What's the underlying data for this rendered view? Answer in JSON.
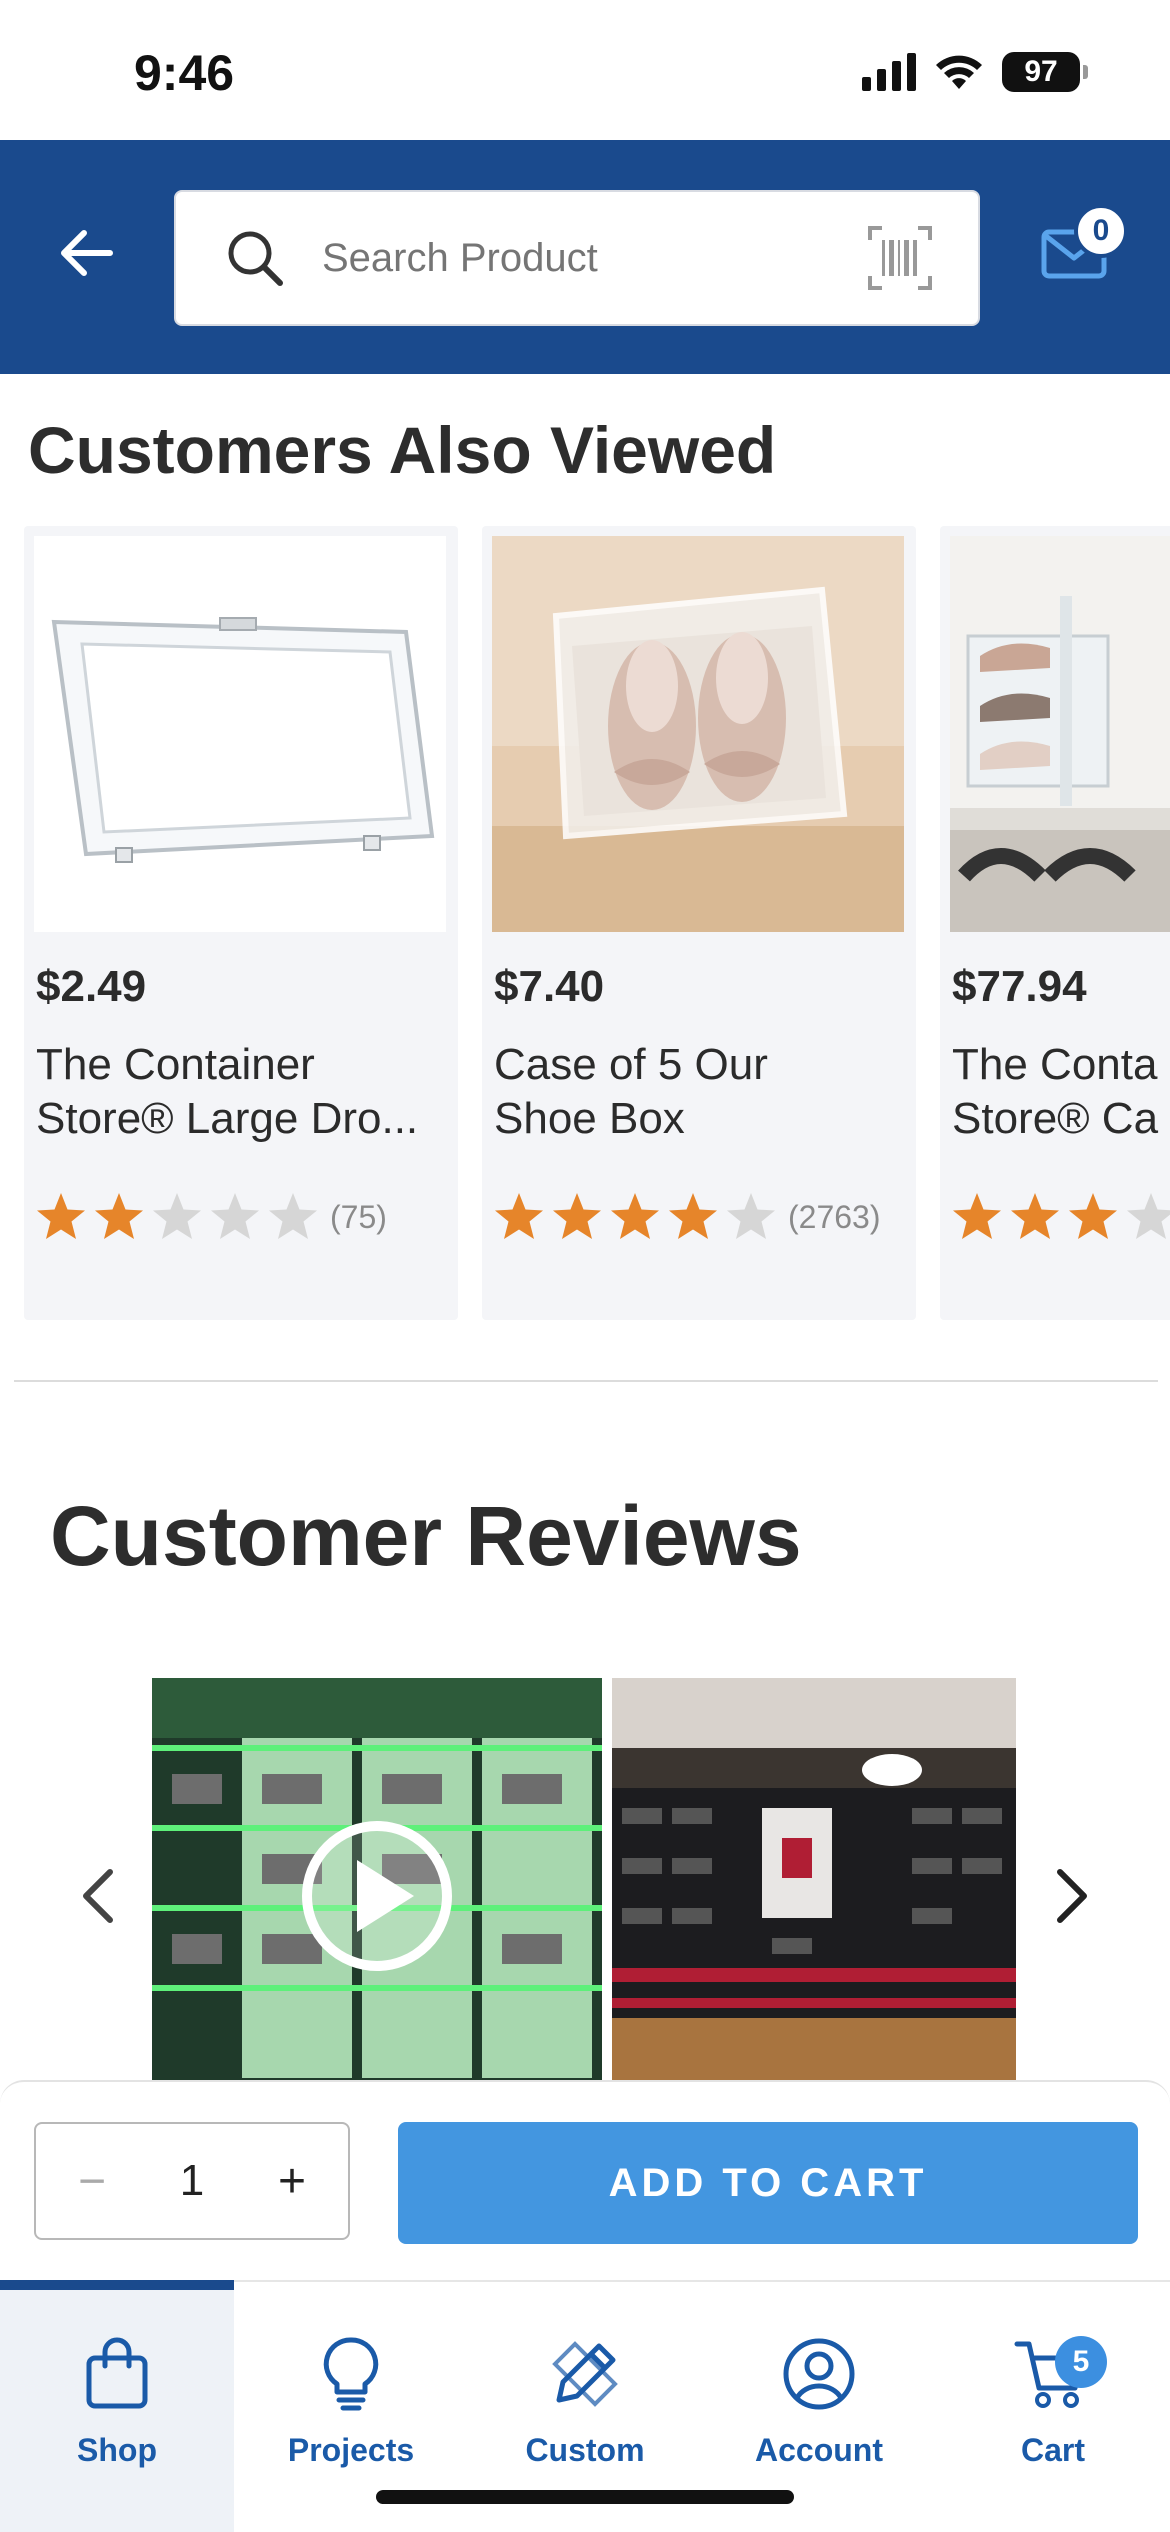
{
  "status_bar": {
    "time": "9:46",
    "battery": "97"
  },
  "header": {
    "search_placeholder": "Search Product",
    "inbox_count": "0"
  },
  "customers_also_viewed": {
    "title": "Customers Also Viewed",
    "products": [
      {
        "price": "$2.49",
        "name_line1": "The Container",
        "name_line2": "Store® Large Dro...",
        "rating": 2,
        "review_count": "(75)"
      },
      {
        "price": "$7.40",
        "name_line1": "Case of 5 Our",
        "name_line2": "Shoe Box",
        "rating": 4,
        "review_count": "(2763)"
      },
      {
        "price": "$77.94",
        "name_line1": "The Conta",
        "name_line2": "Store® Ca",
        "rating": 3,
        "review_count": ""
      }
    ]
  },
  "customer_reviews": {
    "title": "Customer Reviews"
  },
  "purchase": {
    "quantity": "1",
    "add_to_cart_label": "ADD TO CART"
  },
  "bottom_nav": {
    "items": [
      {
        "label": "Shop",
        "active": true
      },
      {
        "label": "Projects",
        "active": false
      },
      {
        "label": "Custom",
        "active": false
      },
      {
        "label": "Account",
        "active": false
      },
      {
        "label": "Cart",
        "active": false
      }
    ],
    "cart_count": "5"
  },
  "colors": {
    "brand_blue": "#1a4a8d",
    "button_blue": "#4396e0",
    "star_orange": "#e6852a",
    "star_empty": "#d6d6d6"
  }
}
